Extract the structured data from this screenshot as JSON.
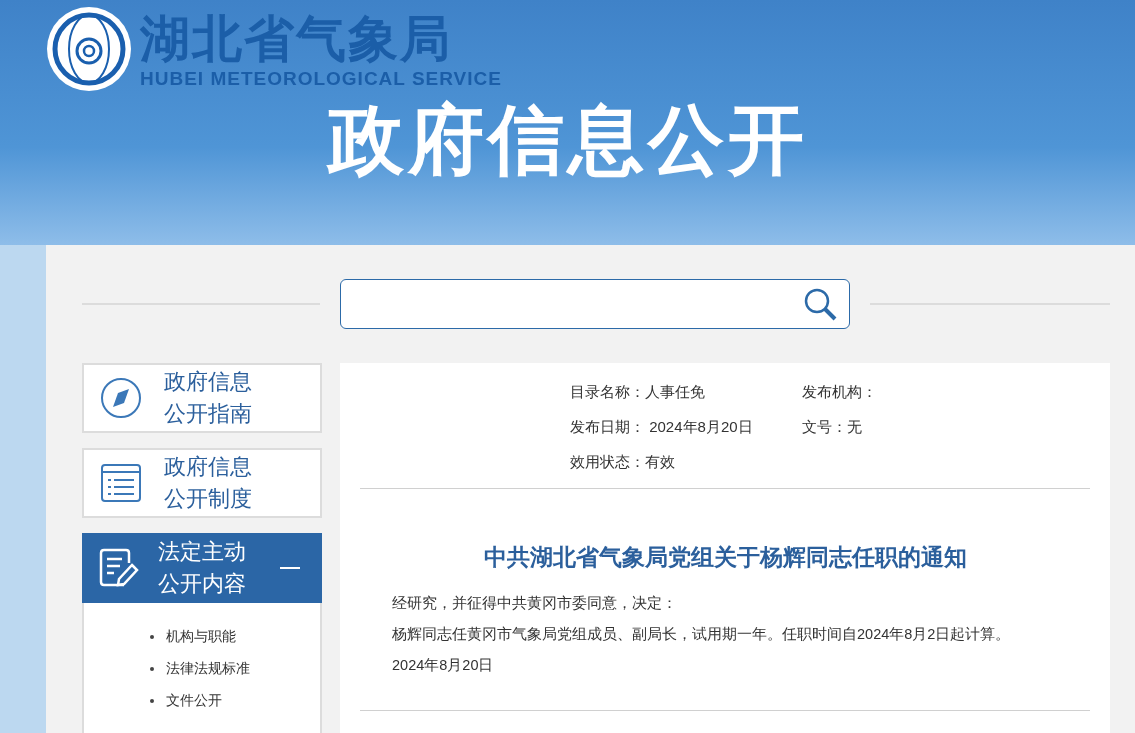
{
  "header": {
    "logo_text": "湖北省气象局",
    "logo_subtitle": "HUBEI METEOROLOGICAL SERVICE",
    "banner": "政府信息公开"
  },
  "sidebar": {
    "items": [
      {
        "kind": "compass",
        "lines": [
          "政府信息",
          "公开指南"
        ],
        "selected": false
      },
      {
        "kind": "list",
        "lines": [
          "政府信息",
          "公开制度"
        ],
        "selected": false
      },
      {
        "kind": "edit",
        "lines": [
          "法定主动",
          "公开内容"
        ],
        "selected": true,
        "children": [
          "机构与职能",
          "法律法规标准",
          "文件公开"
        ]
      }
    ]
  },
  "meta": [
    {
      "label": "目录名称：",
      "value": "人事任免"
    },
    {
      "label": "发布机构："
    },
    {
      "label": "发布日期：",
      "value": " 2024年8月20日"
    },
    {
      "label": "文号：",
      "value": "无"
    },
    {
      "label": "效用状态：",
      "value": "有效"
    }
  ],
  "article": {
    "title": "中共湖北省气象局党组关于杨辉同志任职的通知",
    "paragraphs": [
      "经研究，并征得中共黄冈市委同意，决定：",
      "杨辉同志任黄冈市气象局党组成员、副局长，试用期一年。任职时间自2024年8月2日起计算。",
      "2024年8月20日"
    ]
  }
}
